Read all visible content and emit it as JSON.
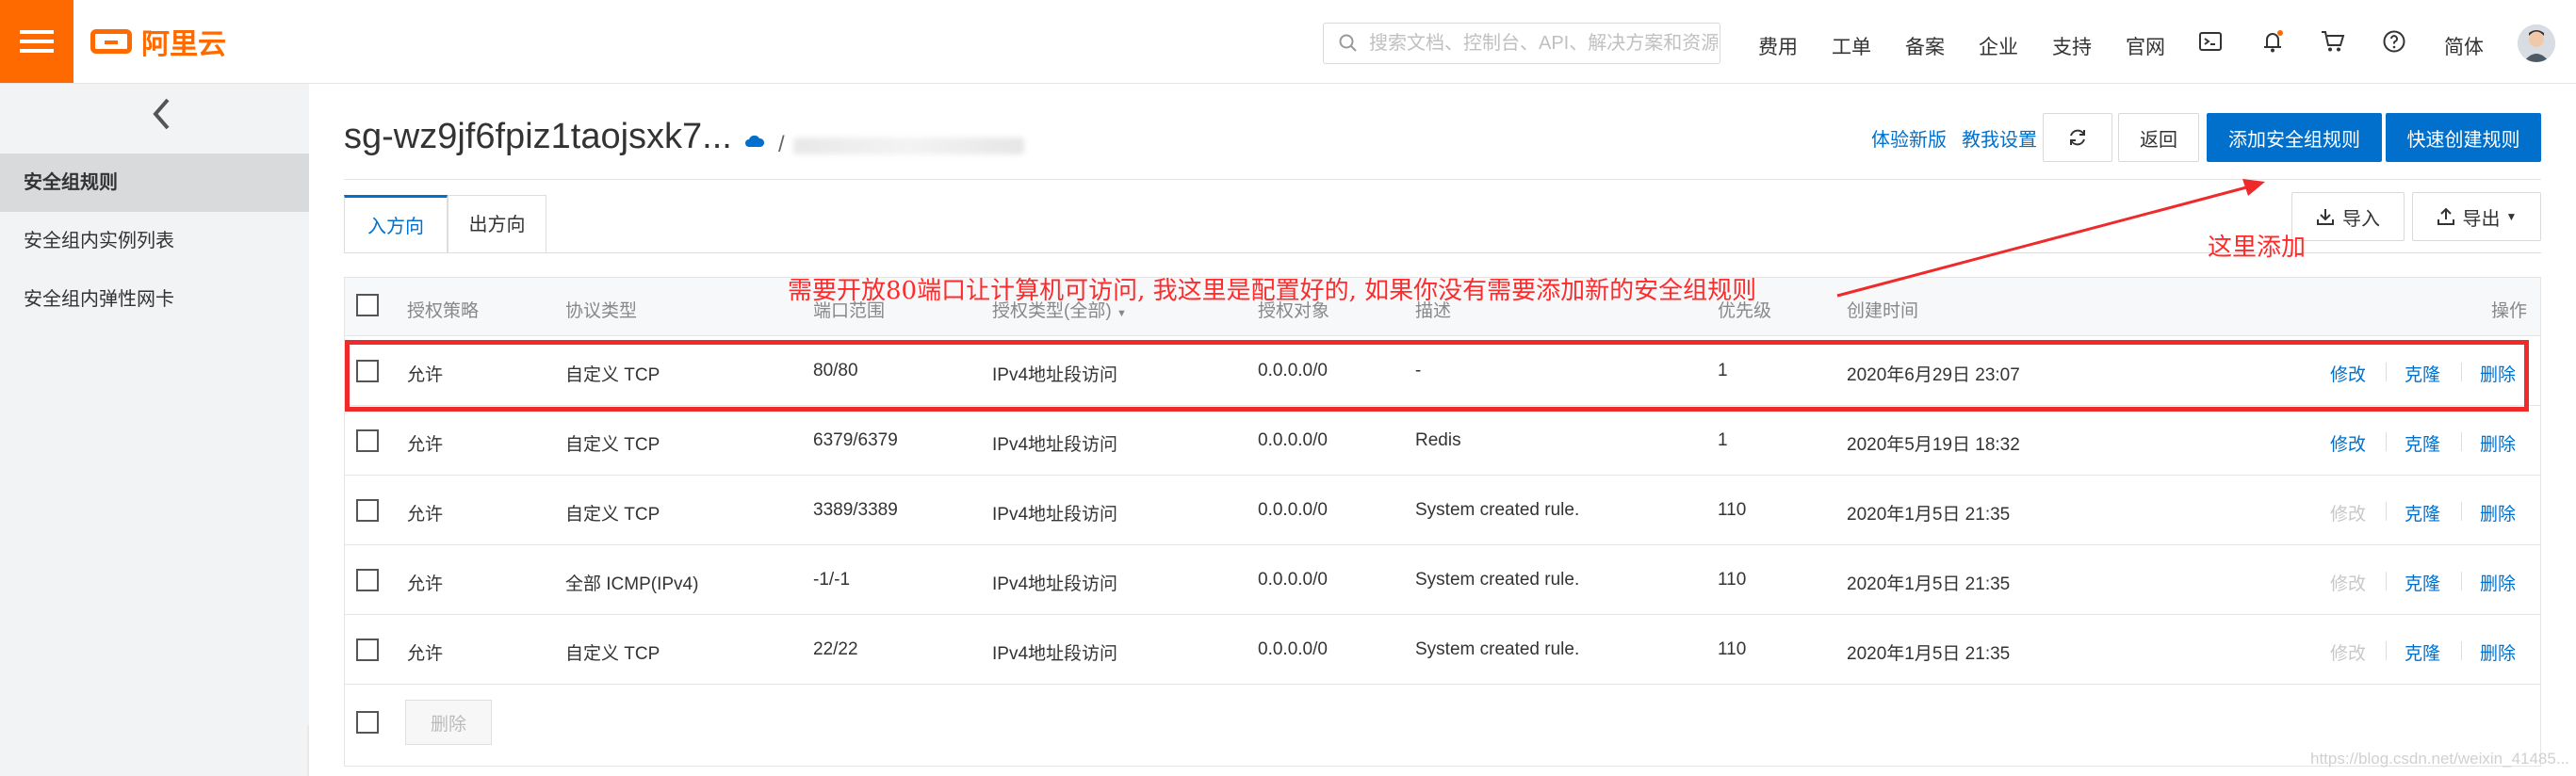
{
  "topbar": {
    "logo_text": "阿里云",
    "search_placeholder": "搜索文档、控制台、API、解决方案和资源",
    "nav": [
      "费用",
      "工单",
      "备案",
      "企业",
      "支持",
      "官网"
    ],
    "lang": "简体",
    "icons": [
      "terminal-icon",
      "bell-icon",
      "cart-icon",
      "help-icon"
    ]
  },
  "sidebar": {
    "items": [
      {
        "label": "安全组规则",
        "active": true
      },
      {
        "label": "安全组内实例列表",
        "active": false
      },
      {
        "label": "安全组内弹性网卡",
        "active": false
      }
    ]
  },
  "header": {
    "title": "sg-wz9jf6fpiz1taojsxk7...",
    "breadcrumb_sep": "/",
    "link_new": "体验新版",
    "link_tutorial": "教我设置",
    "back": "返回",
    "add_rule": "添加安全组规则",
    "quick_rule": "快速创建规则"
  },
  "tabs": [
    {
      "label": "入方向",
      "active": true
    },
    {
      "label": "出方向",
      "active": false
    }
  ],
  "toolbar": {
    "import": "导入",
    "export": "导出"
  },
  "table": {
    "headers": [
      "授权策略",
      "协议类型",
      "端口范围",
      "授权类型(全部)",
      "授权对象",
      "描述",
      "优先级",
      "创建时间",
      "操作"
    ],
    "rows": [
      {
        "policy": "允许",
        "protocol": "自定义 TCP",
        "port": "80/80",
        "auth_type": "IPv4地址段访问",
        "object": "0.0.0.0/0",
        "desc": "-",
        "priority": "1",
        "created": "2020年6月29日 23:07",
        "edit": "修改",
        "clone": "克隆",
        "delete": "删除",
        "edit_enabled": true
      },
      {
        "policy": "允许",
        "protocol": "自定义 TCP",
        "port": "6379/6379",
        "auth_type": "IPv4地址段访问",
        "object": "0.0.0.0/0",
        "desc": "Redis",
        "priority": "1",
        "created": "2020年5月19日 18:32",
        "edit": "修改",
        "clone": "克隆",
        "delete": "删除",
        "edit_enabled": true
      },
      {
        "policy": "允许",
        "protocol": "自定义 TCP",
        "port": "3389/3389",
        "auth_type": "IPv4地址段访问",
        "object": "0.0.0.0/0",
        "desc": "System created rule.",
        "priority": "110",
        "created": "2020年1月5日 21:35",
        "edit": "修改",
        "clone": "克隆",
        "delete": "删除",
        "edit_enabled": false
      },
      {
        "policy": "允许",
        "protocol": "全部 ICMP(IPv4)",
        "port": "-1/-1",
        "auth_type": "IPv4地址段访问",
        "object": "0.0.0.0/0",
        "desc": "System created rule.",
        "priority": "110",
        "created": "2020年1月5日 21:35",
        "edit": "修改",
        "clone": "克隆",
        "delete": "删除",
        "edit_enabled": false
      },
      {
        "policy": "允许",
        "protocol": "自定义 TCP",
        "port": "22/22",
        "auth_type": "IPv4地址段访问",
        "object": "0.0.0.0/0",
        "desc": "System created rule.",
        "priority": "110",
        "created": "2020年1月5日 21:35",
        "edit": "修改",
        "clone": "克隆",
        "delete": "删除",
        "edit_enabled": false
      }
    ],
    "bulk_delete": "删除"
  },
  "annotations": {
    "note": "需要开放80端口让计算机可访问, 我这里是配置好的, 如果你没有需要添加新的安全组规则",
    "arrow_label": "这里添加",
    "color": "#ee2a2a"
  },
  "watermark": "https://blog.csdn.net/weixin_41485..."
}
